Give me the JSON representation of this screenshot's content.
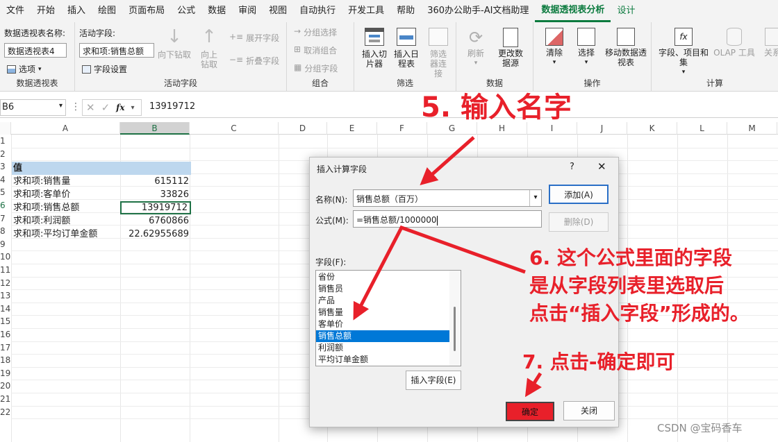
{
  "menu": [
    "文件",
    "开始",
    "插入",
    "绘图",
    "页面布局",
    "公式",
    "数据",
    "审阅",
    "视图",
    "自动执行",
    "开发工具",
    "帮助",
    "360办公助手-AI文档助理",
    "数据透视表分析",
    "设计"
  ],
  "ribbon": {
    "pivot_name_label": "数据透视表名称:",
    "pivot_name_value": "数据透视表4",
    "options_label": "选项",
    "group_pivot": "数据透视表",
    "active_field_label": "活动字段:",
    "active_field_value": "求和项:销售总额",
    "field_settings": "字段设置",
    "drill_down": "向下钻取",
    "drill_up": "向上钻取",
    "expand_field": "展开字段",
    "collapse_field": "折叠字段",
    "group_active_field": "活动字段",
    "group_selection": "分组选择",
    "ungroup": "取消组合",
    "group_field": "分组字段",
    "group_group": "组合",
    "insert_slicer": "插入切片器",
    "insert_timeline": "插入日程表",
    "filter_connections": "筛选器连接",
    "group_filter": "筛选",
    "refresh": "刷新",
    "change_source": "更改数据源",
    "group_data": "数据",
    "clear": "清除",
    "select": "选择",
    "move_pivot": "移动数据透视表",
    "group_actions": "操作",
    "fields_items": "字段、项目和集",
    "olap_tools": "OLAP 工具",
    "relationships": "关系",
    "group_calc": "计算"
  },
  "formula_bar": {
    "cell_ref": "B6",
    "value": "13919712"
  },
  "columns": [
    "A",
    "B",
    "C",
    "D",
    "E",
    "F",
    "G",
    "H",
    "I",
    "J",
    "K",
    "L",
    "M"
  ],
  "row_numbers": [
    "1",
    "2",
    "3",
    "4",
    "5",
    "6",
    "7",
    "8",
    "9",
    "10",
    "11",
    "12",
    "13",
    "14",
    "15",
    "16",
    "17",
    "18",
    "19",
    "20",
    "21",
    "22"
  ],
  "pivot": {
    "header": "值",
    "rows": [
      {
        "label": "求和项:销售量",
        "value": "615112"
      },
      {
        "label": "求和项:客单价",
        "value": "33826"
      },
      {
        "label": "求和项:销售总额",
        "value": "13919712"
      },
      {
        "label": "求和项:利润额",
        "value": "6760866"
      },
      {
        "label": "求和项:平均订单金额",
        "value": "22.62955689"
      }
    ]
  },
  "dialog": {
    "title": "插入计算字段",
    "help": "?",
    "name_label": "名称(N):",
    "name_value": "销售总额（百万）",
    "formula_label": "公式(M):",
    "formula_value": "=销售总额/1000000",
    "add_button": "添加(A)",
    "delete_button": "删除(D)",
    "fields_label": "字段(F):",
    "fields": [
      "省份",
      "销售员",
      "产品",
      "销售量",
      "客单价",
      "销售总额",
      "利润额",
      "平均订单金额"
    ],
    "selected_field": "销售总额",
    "insert_field_button": "插入字段(E)",
    "ok_button": "确定",
    "close_button": "关闭"
  },
  "annotations": {
    "step5": "5. 输入名字",
    "step6_line1": "6. 这个公式里面的字段",
    "step6_line2": "是从字段列表里选取后",
    "step6_line3": "点击“插入字段”形成的。",
    "step7": "7. 点击-确定即可"
  },
  "watermark": "CSDN @宝码香车",
  "colors": {
    "accent_green": "#0b7a3e",
    "annotation_red": "#e8202a",
    "selection_blue": "#0078d7",
    "header_fill": "#bdd7ee"
  }
}
